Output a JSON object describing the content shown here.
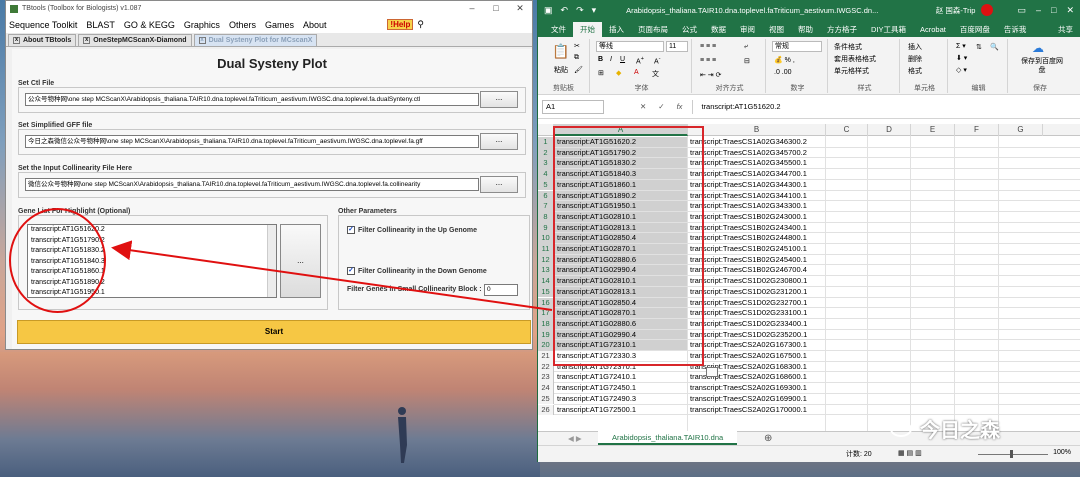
{
  "tbtools": {
    "title": "TBtools (Toolbox for Biologists) v1.087",
    "menu": [
      "Sequence Toolkit",
      "BLAST",
      "GO & KEGG",
      "Graphics",
      "Others",
      "Games",
      "About"
    ],
    "help": "!Help",
    "tabs": [
      "About TBtools",
      "OneStepMCScanX-Diamond",
      "Dual Systeny Plot for MCscanX"
    ],
    "panel_title": "Dual Systeny Plot",
    "ctl_label": "Set Ctl File",
    "ctl_value": "公众号物种网\\one step MCScanX\\Arabidopsis_thaliana.TAIR10.dna.toplevel.faTriticum_aestivum.IWGSC.dna.toplevel.fa.dualSynteny.ctl",
    "gff_label": "Set Simplified GFF file",
    "gff_value": "今日之森微信公众号物种网\\one step MCScanX\\Arabidopsis_thaliana.TAIR10.dna.toplevel.faTriticum_aestivum.IWGSC.dna.toplevel.fa.gff",
    "col_label": "Set the Input Collinearity File Here",
    "col_value": "微信公众号物种网\\one step MCScanX\\Arabidopsis_thaliana.TAIR10.dna.toplevel.faTriticum_aestivum.IWGSC.dna.toplevel.fa.collinearity",
    "browse": "...",
    "genelist_label": "Gene List For Highlight (Optional)",
    "genelist": [
      "transcript:AT1G51620.2",
      "transcript:AT1G51790.2",
      "transcript:AT1G51830.2",
      "transcript:AT1G51840.3",
      "transcript:AT1G51860.1",
      "transcript:AT1G51890.2",
      "transcript:AT1G51950.1"
    ],
    "other_label": "Other Parameters",
    "filter_up": "Filter Collinearity in the Up Genome",
    "filter_down": "Filter Collinearity in the Down Genome",
    "filter_small": "Filter Genes in Small Collinearity Block :",
    "filter_small_value": "0",
    "start": "Start"
  },
  "excel": {
    "title": "Arabidopsis_thaliana.TAIR10.dna.toplevel.faTriticum_aestivum.IWGSC.dn...",
    "user": "赵 国森-Trip",
    "tabs": [
      "文件",
      "开始",
      "插入",
      "页面布局",
      "公式",
      "数据",
      "审阅",
      "视图",
      "帮助",
      "方方格子",
      "DIY工具箱",
      "Acrobat",
      "百度网盘",
      "告诉我",
      "共享"
    ],
    "font": "等线",
    "fontsize": "11",
    "numfmt": "常规",
    "groups": [
      "剪贴板",
      "字体",
      "对齐方式",
      "数字",
      "样式",
      "单元格",
      "编辑",
      "保存"
    ],
    "paste": "粘贴",
    "cond_fmt": "条件格式",
    "table_fmt": "套用表格格式",
    "cell_style": "单元格样式",
    "insert": "插入",
    "delete": "删除",
    "format": "格式",
    "save_baidu": "保存到百度网盘",
    "cell_ref": "A1",
    "formula": "transcript:AT1G51620.2",
    "columns": [
      "A",
      "B",
      "C",
      "D",
      "E",
      "F",
      "G"
    ],
    "rowsA": [
      "transcript:AT1G51620.2",
      "transcript:AT1G51790.2",
      "transcript:AT1G51830.2",
      "transcript:AT1G51840.3",
      "transcript:AT1G51860.1",
      "transcript:AT1G51890.2",
      "transcript:AT1G51950.1",
      "transcript:AT1G02810.1",
      "transcript:AT1G02813.1",
      "transcript:AT1G02850.4",
      "transcript:AT1G02870.1",
      "transcript:AT1G02880.6",
      "transcript:AT1G02990.4",
      "transcript:AT1G02810.1",
      "transcript:AT1G02813.1",
      "transcript:AT1G02850.4",
      "transcript:AT1G02870.1",
      "transcript:AT1G02880.6",
      "transcript:AT1G02990.4",
      "transcript:AT1G72310.1",
      "transcript:AT1G72330.3",
      "transcript:AT1G72370.1",
      "transcript:AT1G72410.1",
      "transcript:AT1G72450.1",
      "transcript:AT1G72490.3",
      "transcript:AT1G72500.1"
    ],
    "rowsB": [
      "transcript:TraesCS1A02G346300.2",
      "transcript:TraesCS1A02G345700.2",
      "transcript:TraesCS1A02G345500.1",
      "transcript:TraesCS1A02G344700.1",
      "transcript:TraesCS1A02G344300.1",
      "transcript:TraesCS1A02G344100.1",
      "transcript:TraesCS1A02G343300.1",
      "transcript:TraesCS1B02G243000.1",
      "transcript:TraesCS1B02G243400.1",
      "transcript:TraesCS1B02G244800.1",
      "transcript:TraesCS1B02G245100.1",
      "transcript:TraesCS1B02G245400.1",
      "transcript:TraesCS1B02G246700.4",
      "transcript:TraesCS1D02G230800.1",
      "transcript:TraesCS1D02G231200.1",
      "transcript:TraesCS1D02G232700.1",
      "transcript:TraesCS1D02G233100.1",
      "transcript:TraesCS1D02G233400.1",
      "transcript:TraesCS1D02G235200.1",
      "transcript:TraesCS2A02G167300.1",
      "transcript:TraesCS2A02G167500.1",
      "transcript:TraesCS2A02G168300.1",
      "transcript:TraesCS2A02G168600.1",
      "transcript:TraesCS2A02G169300.1",
      "transcript:TraesCS2A02G169900.1",
      "transcript:TraesCS2A02G170000.1"
    ],
    "sheet": "Arabidopsis_thaliana.TAIR10.dna",
    "status_count": "计数: 20",
    "zoom": "100%"
  },
  "watermark": "今日之森",
  "accent": "#217346"
}
